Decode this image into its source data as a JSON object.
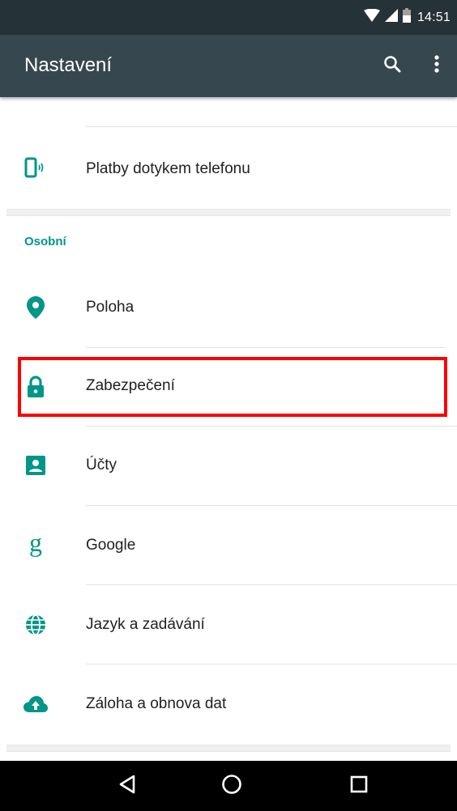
{
  "status_bar": {
    "time": "14:51",
    "icons": [
      "wifi-icon",
      "signal-icon",
      "battery-icon"
    ]
  },
  "app_bar": {
    "title": "Nastavení",
    "actions": [
      "search-icon",
      "more-vert-icon"
    ]
  },
  "top_items": [
    {
      "label": "Platby dotykem telefonu",
      "icon": "nfc-payment-icon"
    }
  ],
  "section": {
    "header": "Osobní",
    "items": [
      {
        "label": "Poloha",
        "icon": "location-pin-icon"
      },
      {
        "label": "Zabezpečení",
        "icon": "lock-icon",
        "highlighted": true
      },
      {
        "label": "Účty",
        "icon": "account-box-icon"
      },
      {
        "label": "Google",
        "icon": "google-g-icon"
      },
      {
        "label": "Jazyk a zadávání",
        "icon": "globe-icon"
      },
      {
        "label": "Záloha a obnova dat",
        "icon": "cloud-upload-icon"
      }
    ]
  },
  "nav_bar": {
    "buttons": [
      "back-icon",
      "home-icon",
      "recents-icon"
    ]
  },
  "colors": {
    "accent": "#009688",
    "status_bar": "#253238",
    "app_bar": "#37474f",
    "highlight": "#ff0000"
  }
}
